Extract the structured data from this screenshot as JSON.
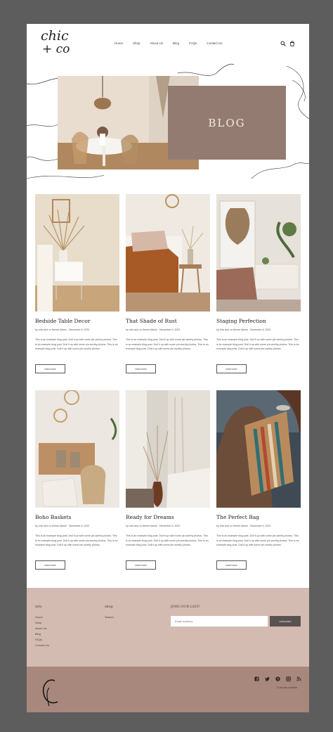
{
  "header": {
    "logo_line1": "chic",
    "logo_line2": "+ co",
    "nav": [
      "Home",
      "Shop",
      "About Us",
      "Blog",
      "FAQs",
      "Contact Us"
    ],
    "icons": [
      "search-icon",
      "cart-icon"
    ]
  },
  "hero": {
    "title": "BLOG",
    "box_color": "#947b72"
  },
  "posts": [
    {
      "title": "Bedside Table Decor",
      "author": "by chic and co theme Admin",
      "date": "December 6, 2021",
      "excerpt": "This is an example blog post. Doll it up with some pin-worthy photos. This is an example blog post. Doll it up with some pin-worthy photos. This is an example blog post. Doll it up with some pin-worthy photos.",
      "button": "read more"
    },
    {
      "title": "That Shade of Rust",
      "author": "by chic and co theme Admin",
      "date": "December 6, 2021",
      "excerpt": "This is an example blog post. Doll it up with some pin-worthy photos. This is an example blog post. Doll it up with some pin-worthy photos. This is an example blog post. Doll it up with some pin-worthy photos.",
      "button": "read more"
    },
    {
      "title": "Staging Perfection",
      "author": "by chic and co theme Admin",
      "date": "December 6, 2021",
      "excerpt": "This is an example blog post. Doll it up with some pin-worthy photos. This is an example blog post. Doll it up with some pin-worthy photos. This is an example blog post. Doll it up with some pin-worthy photos.",
      "button": "read more"
    },
    {
      "title": "Boho Baskets",
      "author": "by chic and co theme Admin",
      "date": "December 6, 2021",
      "excerpt": "This is an example blog post. Doll it up with some pin-worthy photos. This is an example blog post. Doll it up with some pin-worthy photos. This is an example blog post. Doll it up with some pin-worthy photos.",
      "button": "read more"
    },
    {
      "title": "Ready for Dreams",
      "author": "by chic and co theme Admin",
      "date": "December 6, 2021",
      "excerpt": "This is an example blog post. Doll it up with some pin-worthy photos. This is an example blog post. Doll it up with some pin-worthy photos. This is an example blog post. Doll it up with some pin-worthy photos.",
      "button": "read more"
    },
    {
      "title": "The Perfect Bag",
      "author": "by chic and co theme Admin",
      "date": "December 6, 2021",
      "excerpt": "This is an example blog post. Doll it up with some pin-worthy photos. This is an example blog post. Doll it up with some pin-worthy photos. This is an example blog post. Doll it up with some pin-worthy photos.",
      "button": "read more"
    }
  ],
  "footer": {
    "info_heading": "info",
    "info_links": [
      "Home",
      "Shop",
      "About Us",
      "Blog",
      "FAQs",
      "Contact Us"
    ],
    "shop_heading": "shop",
    "shop_links": [
      "Search"
    ],
    "newsletter_heading": "JOIN OUR LIST!",
    "email_placeholder": "Email address",
    "subscribe_label": "subscribe",
    "social_icons": [
      "facebook-icon",
      "twitter-icon",
      "pinterest-icon",
      "instagram-icon",
      "rss-icon"
    ],
    "copyright": "© chic and co theme",
    "top_color": "#d3bbb1",
    "bottom_color": "#a8887d"
  }
}
